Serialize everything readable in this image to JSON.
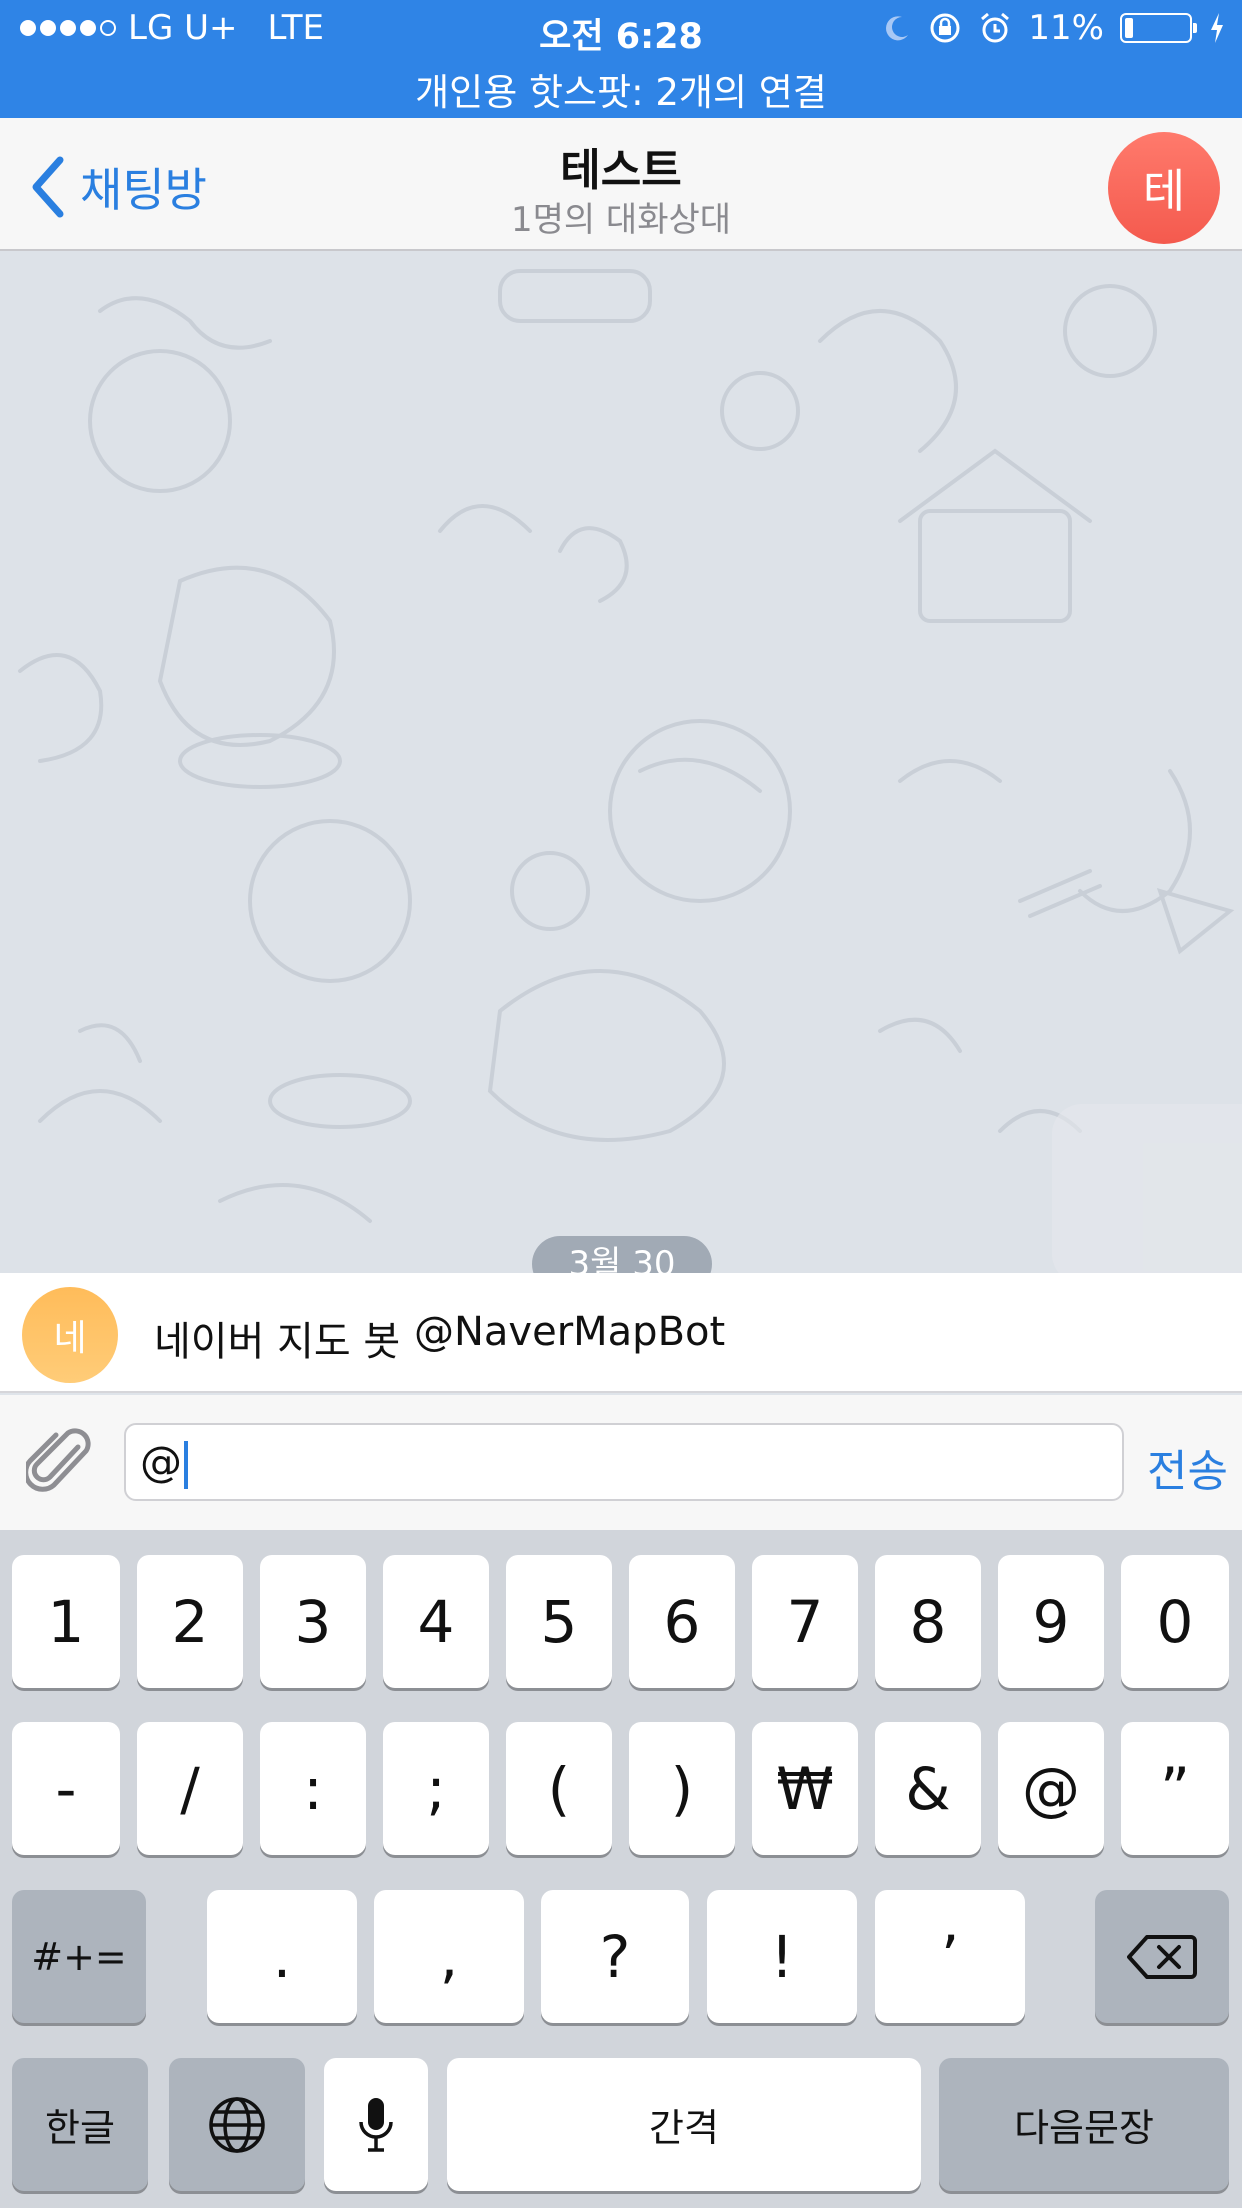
{
  "status_bar": {
    "carrier": "LG U+",
    "network": "LTE",
    "time": "오전 6:28",
    "battery": "11%",
    "battery_level": 0.11,
    "hotspot": "개인용 핫스팟: 2개의 연결"
  },
  "nav": {
    "back_label": "채팅방",
    "title": "테스트",
    "subtitle": "1명의 대화상대",
    "avatar_initial": "테"
  },
  "chat": {
    "date_badge": "3월 30"
  },
  "mention": {
    "avatar_initial": "네",
    "name": "네이버 지도 봇",
    "username": "@NaverMapBot"
  },
  "input": {
    "value": "@",
    "send_label": "전송"
  },
  "keyboard": {
    "row1": [
      "1",
      "2",
      "3",
      "4",
      "5",
      "6",
      "7",
      "8",
      "9",
      "0"
    ],
    "row2": [
      "-",
      "/",
      ":",
      ";",
      "(",
      ")",
      "₩",
      "&",
      "@",
      "”"
    ],
    "row3": [
      ".",
      ",",
      "?",
      "!",
      "’"
    ],
    "symbols_label": "#+=",
    "lang_label": "한글",
    "space_label": "간격",
    "return_label": "다음문장"
  },
  "colors": {
    "accent": "#2f84e6",
    "link": "#2a7fe0"
  }
}
